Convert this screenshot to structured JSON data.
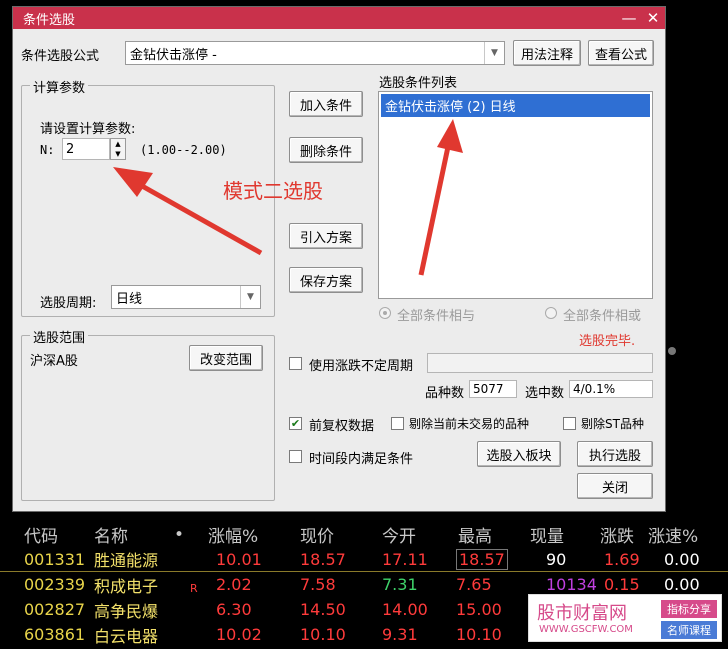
{
  "window": {
    "title": "条件选股",
    "minimize": "—",
    "close": "✕"
  },
  "formula": {
    "label": "条件选股公式",
    "value": "金钻伏击涨停 -",
    "help_button": "用法注释",
    "view_button": "查看公式"
  },
  "params": {
    "group_title": "计算参数",
    "prompt": "请设置计算参数:",
    "n_label": "N:",
    "n_value": "2",
    "n_range": "(1.00--2.00)",
    "period_label": "选股周期:",
    "period_value": "日线"
  },
  "buttons": {
    "add": "加入条件",
    "delete": "删除条件",
    "import": "引入方案",
    "save": "保存方案",
    "to_board": "选股入板块",
    "execute": "执行选股",
    "close": "关闭"
  },
  "conditions": {
    "title": "选股条件列表",
    "items": [
      "金钻伏击涨停 (2) 日线"
    ]
  },
  "annotation": "模式二选股",
  "logic": {
    "all_and": "全部条件相与",
    "all_or": "全部条件相或"
  },
  "status": "选股完毕.",
  "scope": {
    "group_title": "选股范围",
    "value": "沪深A股",
    "change_button": "改变范围"
  },
  "options": {
    "variable_period": "使用涨跌不定周期",
    "count_label": "品种数",
    "count_value": "5077",
    "selected_label": "选中数",
    "selected_value": "4/0.1%",
    "pre_adjust": "前复权数据",
    "exclude_untraded": "剔除当前未交易的品种",
    "exclude_st": "剔除ST品种",
    "time_range": "时间段内满足条件"
  },
  "table": {
    "headers": [
      "代码",
      "名称",
      "•",
      "涨幅%",
      "现价",
      "今开",
      "最高",
      "现量",
      "涨跌",
      "涨速%"
    ],
    "rows": [
      {
        "code": "001331",
        "name": "胜通能源",
        "flag": "",
        "pct": "10.01",
        "price": "18.57",
        "open": "17.11",
        "high": "18.57",
        "vol": "90",
        "chg": "1.69",
        "speed": "0.00"
      },
      {
        "code": "002339",
        "name": "积成电子",
        "flag": "R",
        "pct": "2.02",
        "price": "7.58",
        "open": "7.31",
        "high": "7.65",
        "vol": "10134",
        "chg": "0.15",
        "speed": "0.00"
      },
      {
        "code": "002827",
        "name": "高争民爆",
        "flag": "",
        "pct": "6.30",
        "price": "14.50",
        "open": "14.00",
        "high": "15.00",
        "vol": "",
        "chg": "",
        "speed": ""
      },
      {
        "code": "603861",
        "name": "白云电器",
        "flag": "",
        "pct": "10.02",
        "price": "10.10",
        "open": "9.31",
        "high": "10.10",
        "vol": "",
        "chg": "",
        "speed": ""
      }
    ]
  },
  "watermark": {
    "main": "股市财富网",
    "url": "WWW.GSCFW.COM",
    "tag1": "指标分享",
    "tag2": "名师课程"
  },
  "colors": {
    "titlebar": "#c9314b",
    "up": "#ff3b3b",
    "down": "#3fd36a",
    "code": "#e8d44a",
    "name": "#f2e06a"
  }
}
